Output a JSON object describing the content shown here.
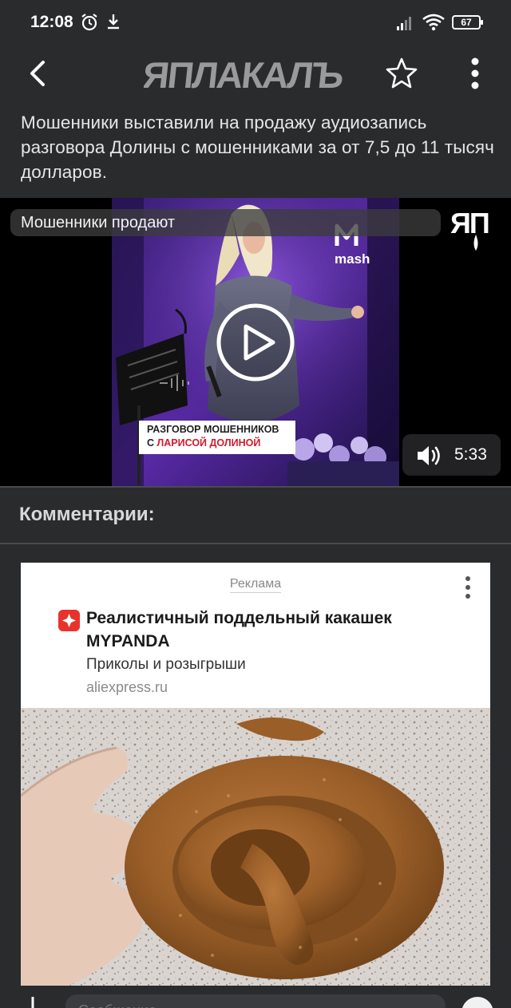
{
  "status_bar": {
    "time": "12:08",
    "icons": [
      "alarm-icon",
      "download-icon",
      "signal-icon",
      "wifi-icon"
    ],
    "battery": "67"
  },
  "header": {
    "logo_text": "ЯПЛАКАЛЪ",
    "icons": [
      "back-arrow-icon",
      "star-icon",
      "more-vert-icon"
    ]
  },
  "post": {
    "text": "Мошенники выставили на продажу аудиозапись разговора Долины с мошенниками за от 7,5 до 11 тысяч долларов."
  },
  "video": {
    "title": "Мошенники продают",
    "watermark": "ЯП",
    "mash_label": "mash",
    "caption_line1": "РАЗГОВОР МОШЕННИКОВ",
    "caption_prefix": "С ",
    "caption_highlight": "ЛАРИСОЙ ДОЛИНОЙ",
    "duration": "5:33",
    "icons": [
      "play-icon",
      "volume-icon"
    ]
  },
  "comments": {
    "heading": "Комментарии:"
  },
  "ad": {
    "label": "Реклама",
    "title": "Реалистичный поддельный какашек MYPANDA",
    "subtitle": "Приколы и розыгрыши",
    "domain": "aliexpress.ru",
    "icons": [
      "ad-more-icon",
      "aliexpress-icon"
    ]
  },
  "composer": {
    "placeholder": "Сообщение"
  },
  "colors": {
    "background": "#2a2b2d",
    "ad_accent": "#e8332d",
    "caption_highlight": "#d21b2c"
  }
}
